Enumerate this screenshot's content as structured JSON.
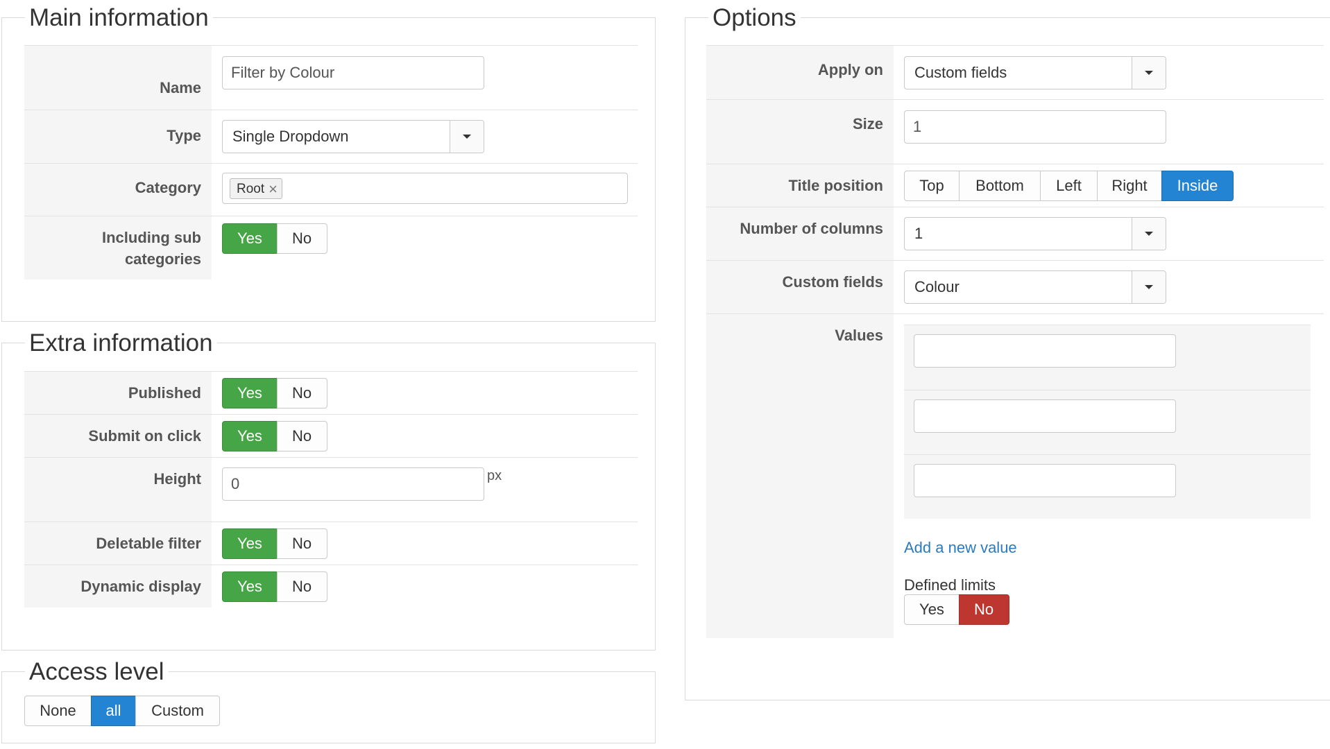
{
  "main_info": {
    "legend": "Main information",
    "name": {
      "label": "Name",
      "value": "Filter by Colour"
    },
    "type": {
      "label": "Type",
      "value": "Single Dropdown"
    },
    "category": {
      "label": "Category",
      "tag": "Root"
    },
    "including_sub": {
      "label_line1": "Including sub",
      "label_line2": "categories",
      "yes": "Yes",
      "no": "No",
      "selected": "Yes"
    }
  },
  "extra_info": {
    "legend": "Extra information",
    "published": {
      "label": "Published",
      "yes": "Yes",
      "no": "No",
      "selected": "Yes"
    },
    "submit_on_click": {
      "label": "Submit on click",
      "yes": "Yes",
      "no": "No",
      "selected": "Yes"
    },
    "height": {
      "label": "Height",
      "value": "0",
      "suffix": "px"
    },
    "deletable_filter": {
      "label": "Deletable filter",
      "yes": "Yes",
      "no": "No",
      "selected": "Yes"
    },
    "dynamic_display": {
      "label": "Dynamic display",
      "yes": "Yes",
      "no": "No",
      "selected": "Yes"
    }
  },
  "access_level": {
    "legend": "Access level",
    "options": [
      "None",
      "all",
      "Custom"
    ],
    "selected": "all"
  },
  "options": {
    "legend": "Options",
    "apply_on": {
      "label": "Apply on",
      "value": "Custom fields"
    },
    "size": {
      "label": "Size",
      "value": "1"
    },
    "title_position": {
      "label": "Title position",
      "options": [
        "Top",
        "Bottom",
        "Left",
        "Right",
        "Inside"
      ],
      "selected": "Inside"
    },
    "number_of_columns": {
      "label": "Number of columns",
      "value": "1"
    },
    "custom_fields": {
      "label": "Custom fields",
      "value": "Colour"
    },
    "values": {
      "label": "Values",
      "items": [
        "",
        "",
        ""
      ],
      "add_link": "Add a new value"
    },
    "defined_limits": {
      "label": "Defined limits",
      "yes": "Yes",
      "no": "No",
      "selected": "No"
    }
  },
  "colors": {
    "yes_active": "#46a546",
    "selected_blue": "#2384d3",
    "no_active": "#bd362f",
    "link": "#2a7ac0"
  }
}
